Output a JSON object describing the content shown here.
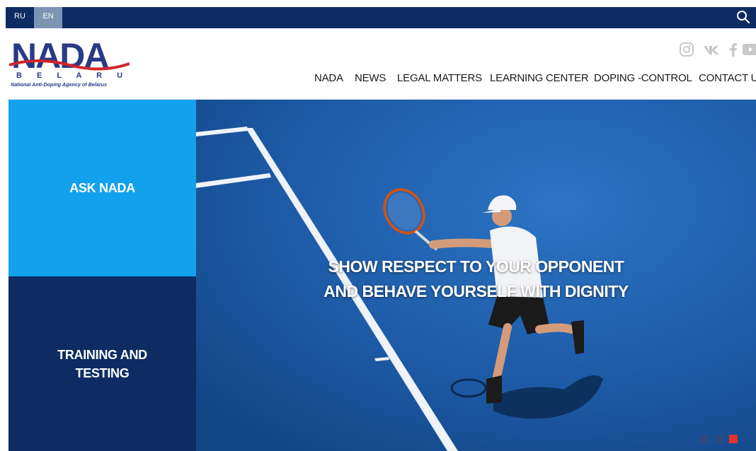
{
  "topbar": {
    "lang_ru": "RU",
    "lang_en": "EN",
    "active_lang": "EN",
    "search_icon": "search-icon"
  },
  "logo": {
    "title": "NADA",
    "subtitle": "B E L A R U S",
    "tagline": "National Anti-Doping Agency of Belarus"
  },
  "social": [
    "instagram-icon",
    "vk-icon",
    "facebook-icon",
    "youtube-icon"
  ],
  "nav": {
    "items": [
      "NADA",
      "NEWS",
      "LEGAL MATTERS",
      "LEARNING CENTER",
      "DOPING -CONTROL",
      "CONTACT US"
    ]
  },
  "tiles": {
    "ask": "ASK NADA",
    "training_line1": "TRAINING AND",
    "training_line2": "TESTING"
  },
  "hero": {
    "line1": "SHOW RESPECT TO YOUR OPPONENT",
    "line2": "AND BEHAVE YOURSELF WITH DIGNITY",
    "slide_count": 3,
    "active_slide": 3
  },
  "colors": {
    "navy": "#0c2c63",
    "light_blue": "#13a0ec",
    "active_lang_bg": "#7d93b4",
    "dot_inactive": "#2c4a80",
    "dot_active": "#e5322d",
    "logo_red": "#d2232a"
  }
}
